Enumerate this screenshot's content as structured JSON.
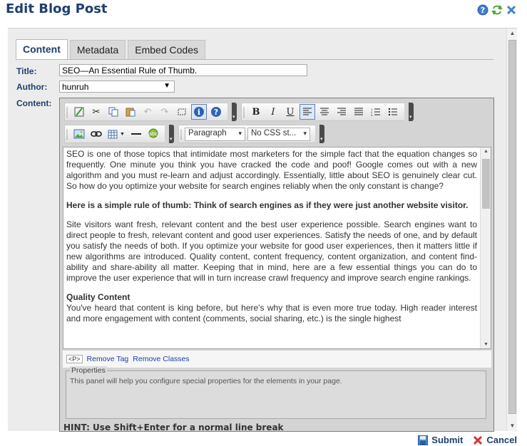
{
  "page": {
    "title": "Edit Blog Post",
    "icons": [
      "help-icon",
      "refresh-icon",
      "close-icon"
    ]
  },
  "tabs": [
    {
      "label": "Content",
      "active": true
    },
    {
      "label": "Metadata",
      "active": false
    },
    {
      "label": "Embed Codes",
      "active": false
    }
  ],
  "form": {
    "title_label": "Title:",
    "title_value": "SEO—An Essential Rule of Thumb.",
    "author_label": "Author:",
    "author_value": "hunruh",
    "content_label": "Content:"
  },
  "editor": {
    "block_format": "Paragraph",
    "css_class": "No CSS st...",
    "paragraphs": [
      {
        "style": "normal",
        "text": "SEO is one of those topics that intimidate most marketers for the simple fact that the equation changes so frequently. One minute you think you have cracked the code and poof! Google comes out with a new algorithm and you must re-learn and adjust accordingly. Essentially, little about SEO is genuinely clear cut. So how do you optimize your website for search engines reliably when the only constant is change?"
      },
      {
        "style": "bold",
        "text": "Here is a simple rule of thumb: Think of search engines as if they were just another website visitor."
      },
      {
        "style": "normal",
        "text": "Site visitors want fresh, relevant content and the best user experience possible. Search engines want to direct people to fresh, relevant content and good user experiences. Satisfy the needs of one, and by default you satisfy the needs of both. If you optimize your website for good user experiences, then it matters little if new algorithms are introduced. Quality content, content frequency, content organization, and content find-ability and share-ability all matter. Keeping that in mind, here are a few essential things you can do to improve the user experience that will in turn increase crawl frequency and improve search engine rankings."
      },
      {
        "style": "heading",
        "heading": "Quality Content",
        "text": "You've heard that content is king before, but here's why that is even more true today. High reader interest and more engagement with content (comments, social sharing, etc.) is the single highest"
      }
    ],
    "tagbar": {
      "tag": "<P>",
      "remove_tag": "Remove Tag",
      "remove_classes": "Remove Classes"
    },
    "properties": {
      "legend": "Properties",
      "description": "This panel will help you configure special properties for the elements in your page."
    },
    "hint": "HINT: Use Shift+Enter for a normal line break"
  },
  "footer": {
    "submit_label": "Submit",
    "cancel_label": "Cancel"
  },
  "colors": {
    "brand_blue": "#1f3f6e",
    "link_blue": "#1a3ea8",
    "cancel_red": "#d9302c"
  }
}
